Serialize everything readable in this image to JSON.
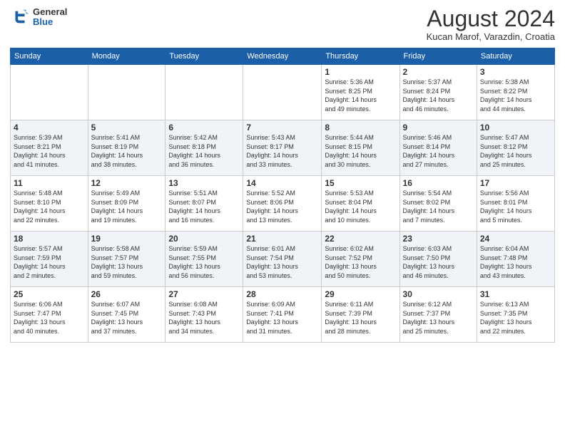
{
  "header": {
    "logo_general": "General",
    "logo_blue": "Blue",
    "month_title": "August 2024",
    "location": "Kucan Marof, Varazdin, Croatia"
  },
  "days_of_week": [
    "Sunday",
    "Monday",
    "Tuesday",
    "Wednesday",
    "Thursday",
    "Friday",
    "Saturday"
  ],
  "weeks": [
    [
      {
        "day": "",
        "info": ""
      },
      {
        "day": "",
        "info": ""
      },
      {
        "day": "",
        "info": ""
      },
      {
        "day": "",
        "info": ""
      },
      {
        "day": "1",
        "info": "Sunrise: 5:36 AM\nSunset: 8:25 PM\nDaylight: 14 hours\nand 49 minutes."
      },
      {
        "day": "2",
        "info": "Sunrise: 5:37 AM\nSunset: 8:24 PM\nDaylight: 14 hours\nand 46 minutes."
      },
      {
        "day": "3",
        "info": "Sunrise: 5:38 AM\nSunset: 8:22 PM\nDaylight: 14 hours\nand 44 minutes."
      }
    ],
    [
      {
        "day": "4",
        "info": "Sunrise: 5:39 AM\nSunset: 8:21 PM\nDaylight: 14 hours\nand 41 minutes."
      },
      {
        "day": "5",
        "info": "Sunrise: 5:41 AM\nSunset: 8:19 PM\nDaylight: 14 hours\nand 38 minutes."
      },
      {
        "day": "6",
        "info": "Sunrise: 5:42 AM\nSunset: 8:18 PM\nDaylight: 14 hours\nand 36 minutes."
      },
      {
        "day": "7",
        "info": "Sunrise: 5:43 AM\nSunset: 8:17 PM\nDaylight: 14 hours\nand 33 minutes."
      },
      {
        "day": "8",
        "info": "Sunrise: 5:44 AM\nSunset: 8:15 PM\nDaylight: 14 hours\nand 30 minutes."
      },
      {
        "day": "9",
        "info": "Sunrise: 5:46 AM\nSunset: 8:14 PM\nDaylight: 14 hours\nand 27 minutes."
      },
      {
        "day": "10",
        "info": "Sunrise: 5:47 AM\nSunset: 8:12 PM\nDaylight: 14 hours\nand 25 minutes."
      }
    ],
    [
      {
        "day": "11",
        "info": "Sunrise: 5:48 AM\nSunset: 8:10 PM\nDaylight: 14 hours\nand 22 minutes."
      },
      {
        "day": "12",
        "info": "Sunrise: 5:49 AM\nSunset: 8:09 PM\nDaylight: 14 hours\nand 19 minutes."
      },
      {
        "day": "13",
        "info": "Sunrise: 5:51 AM\nSunset: 8:07 PM\nDaylight: 14 hours\nand 16 minutes."
      },
      {
        "day": "14",
        "info": "Sunrise: 5:52 AM\nSunset: 8:06 PM\nDaylight: 14 hours\nand 13 minutes."
      },
      {
        "day": "15",
        "info": "Sunrise: 5:53 AM\nSunset: 8:04 PM\nDaylight: 14 hours\nand 10 minutes."
      },
      {
        "day": "16",
        "info": "Sunrise: 5:54 AM\nSunset: 8:02 PM\nDaylight: 14 hours\nand 7 minutes."
      },
      {
        "day": "17",
        "info": "Sunrise: 5:56 AM\nSunset: 8:01 PM\nDaylight: 14 hours\nand 5 minutes."
      }
    ],
    [
      {
        "day": "18",
        "info": "Sunrise: 5:57 AM\nSunset: 7:59 PM\nDaylight: 14 hours\nand 2 minutes."
      },
      {
        "day": "19",
        "info": "Sunrise: 5:58 AM\nSunset: 7:57 PM\nDaylight: 13 hours\nand 59 minutes."
      },
      {
        "day": "20",
        "info": "Sunrise: 5:59 AM\nSunset: 7:55 PM\nDaylight: 13 hours\nand 56 minutes."
      },
      {
        "day": "21",
        "info": "Sunrise: 6:01 AM\nSunset: 7:54 PM\nDaylight: 13 hours\nand 53 minutes."
      },
      {
        "day": "22",
        "info": "Sunrise: 6:02 AM\nSunset: 7:52 PM\nDaylight: 13 hours\nand 50 minutes."
      },
      {
        "day": "23",
        "info": "Sunrise: 6:03 AM\nSunset: 7:50 PM\nDaylight: 13 hours\nand 46 minutes."
      },
      {
        "day": "24",
        "info": "Sunrise: 6:04 AM\nSunset: 7:48 PM\nDaylight: 13 hours\nand 43 minutes."
      }
    ],
    [
      {
        "day": "25",
        "info": "Sunrise: 6:06 AM\nSunset: 7:47 PM\nDaylight: 13 hours\nand 40 minutes."
      },
      {
        "day": "26",
        "info": "Sunrise: 6:07 AM\nSunset: 7:45 PM\nDaylight: 13 hours\nand 37 minutes."
      },
      {
        "day": "27",
        "info": "Sunrise: 6:08 AM\nSunset: 7:43 PM\nDaylight: 13 hours\nand 34 minutes."
      },
      {
        "day": "28",
        "info": "Sunrise: 6:09 AM\nSunset: 7:41 PM\nDaylight: 13 hours\nand 31 minutes."
      },
      {
        "day": "29",
        "info": "Sunrise: 6:11 AM\nSunset: 7:39 PM\nDaylight: 13 hours\nand 28 minutes."
      },
      {
        "day": "30",
        "info": "Sunrise: 6:12 AM\nSunset: 7:37 PM\nDaylight: 13 hours\nand 25 minutes."
      },
      {
        "day": "31",
        "info": "Sunrise: 6:13 AM\nSunset: 7:35 PM\nDaylight: 13 hours\nand 22 minutes."
      }
    ]
  ]
}
